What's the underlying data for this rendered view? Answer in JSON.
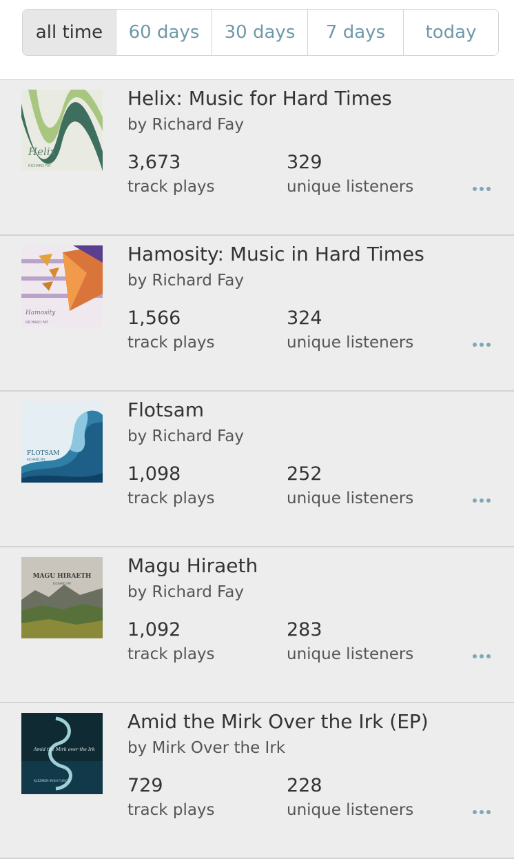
{
  "tabs": [
    {
      "label": "all time",
      "active": true
    },
    {
      "label": "60 days",
      "active": false
    },
    {
      "label": "30 days",
      "active": false
    },
    {
      "label": "7 days",
      "active": false
    },
    {
      "label": "today",
      "active": false
    }
  ],
  "albums": [
    {
      "title": "Helix: Music for Hard Times",
      "artist": "by Richard Fay",
      "plays": "3,673",
      "plays_label": "track plays",
      "listeners": "329",
      "listeners_label": "unique listeners",
      "cover_text": "Helix",
      "cover_subtext": "RICHARD FAY"
    },
    {
      "title": "Hamosity: Music in Hard Times",
      "artist": "by Richard Fay",
      "plays": "1,566",
      "plays_label": "track plays",
      "listeners": "324",
      "listeners_label": "unique listeners",
      "cover_text": "Hamosity",
      "cover_subtext": "RICHARD FAY"
    },
    {
      "title": "Flotsam",
      "artist": "by Richard Fay",
      "plays": "1,098",
      "plays_label": "track plays",
      "listeners": "252",
      "listeners_label": "unique listeners",
      "cover_text": "FLOTSAM",
      "cover_subtext": "RICHARD FAY"
    },
    {
      "title": "Magu Hiraeth",
      "artist": "by Richard Fay",
      "plays": "1,092",
      "plays_label": "track plays",
      "listeners": "283",
      "listeners_label": "unique listeners",
      "cover_text": "MAGU HIRAETH",
      "cover_subtext": "RICHARD FAY"
    },
    {
      "title": "Amid the Mirk Over the Irk (EP)",
      "artist": "by Mirk Over the Irk",
      "plays": "729",
      "plays_label": "track plays",
      "listeners": "228",
      "listeners_label": "unique listeners",
      "cover_text": "Amid the Mirk over the Irk",
      "cover_subtext": "KLEZMER-IRISH FUSION"
    }
  ],
  "colors": {
    "accent": "#6f98a8",
    "dots": "#7fa6b5"
  }
}
